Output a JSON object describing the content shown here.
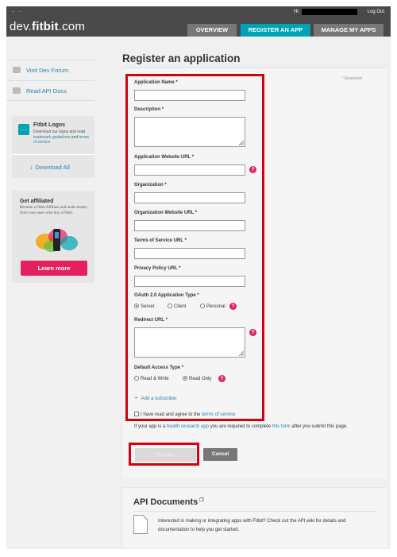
{
  "header": {
    "arrows": "← →",
    "logo_prefix": "dev.",
    "logo_brand": "fitbit",
    "logo_suffix": ".com",
    "greeting": "Hi",
    "logout": "Log Out",
    "tabs": [
      {
        "label": "OVERVIEW"
      },
      {
        "label": "REGISTER AN APP"
      },
      {
        "label": "MANAGE MY APPS"
      }
    ]
  },
  "sidebar": {
    "links": [
      {
        "label": "Visit Dev Forum"
      },
      {
        "label": "Read API Docs"
      }
    ],
    "logos": {
      "title": "Fitbit Logos",
      "text_before": "Download our logos and read ",
      "trademark_link": "trademark guidelines",
      "text_and": " and ",
      "terms_link": "terms of service",
      "download": "Download All"
    },
    "affiliate": {
      "title": "Get affiliated",
      "text": "Become a Fitbit Affiliate and make money from your users who buy a Fitbit.",
      "button": "Learn more"
    }
  },
  "form": {
    "title": "Register an application",
    "required_note": "* Required",
    "fields": {
      "app_name": {
        "label": "Application Name *",
        "value": ""
      },
      "description": {
        "label": "Description *",
        "value": ""
      },
      "website": {
        "label": "Application Website URL *",
        "value": ""
      },
      "organization": {
        "label": "Organization *",
        "value": ""
      },
      "org_website": {
        "label": "Organization Website URL *",
        "value": ""
      },
      "tos": {
        "label": "Terms of Service URL *",
        "value": ""
      },
      "privacy": {
        "label": "Privacy Policy URL *",
        "value": ""
      },
      "oauth_type": {
        "label": "OAuth 2.0 Application Type *",
        "options": [
          "Server",
          "Client",
          "Personal"
        ],
        "selected": "Server"
      },
      "redirect": {
        "label": "Redirect URL *",
        "value": ""
      },
      "access": {
        "label": "Default Access Type *",
        "options": [
          "Read & Write",
          "Read Only"
        ],
        "selected": "Read Only"
      }
    },
    "add_subscriber": "Add a subscriber",
    "agree_text": "I have read and agree to the ",
    "agree_link": "terms of service",
    "research_1": "If your app is a ",
    "research_link1": "health research app",
    "research_2": " you are required to complete ",
    "research_link2": "this form",
    "research_3": " after you submit this page.",
    "register_button": "Register",
    "cancel_button": "Cancel",
    "help_glyph": "?"
  },
  "api_docs": {
    "title": "API Documents",
    "ext_glyph": "❐",
    "text": "Interested in making or integrating apps with Fitbit? Check out the API wiki for details and documentation to help you get started."
  },
  "colors": {
    "accent": "#00a3b4",
    "highlight": "#d4000c",
    "pink": "#e4215f",
    "link": "#2a7fb0"
  }
}
